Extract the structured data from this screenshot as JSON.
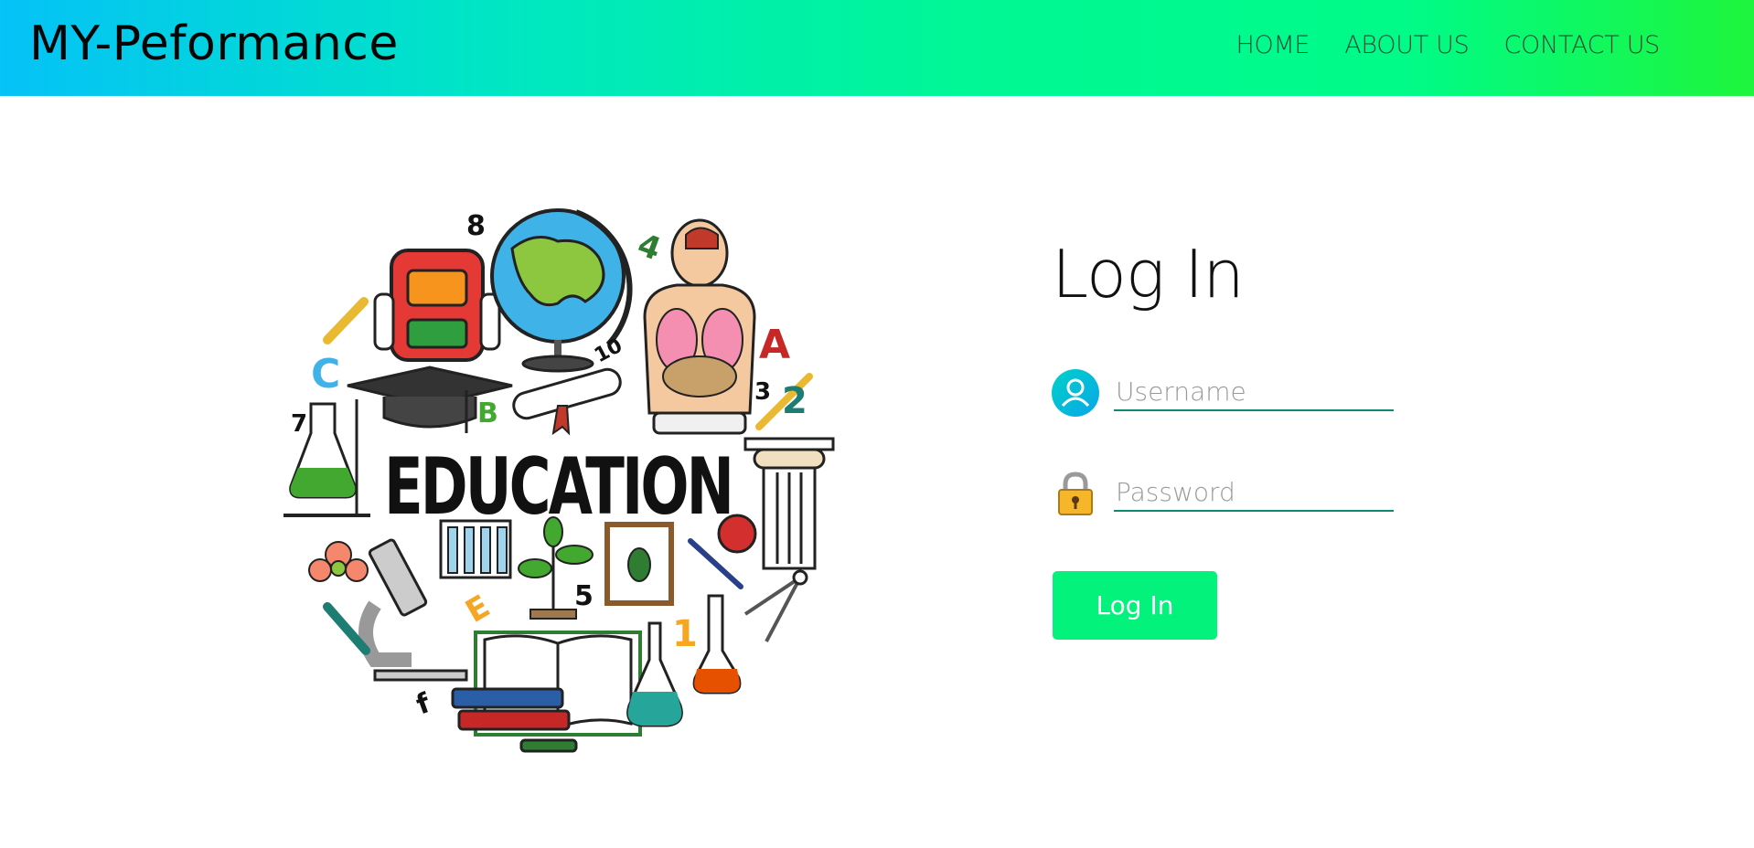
{
  "header": {
    "brand": "MY-Peformance",
    "nav": [
      "HOME",
      "ABOUT US",
      "CONTACT US"
    ]
  },
  "illustration": {
    "title": "EDUCATION",
    "numbers": [
      "8",
      "10",
      "3",
      "7",
      "5",
      "1"
    ],
    "letters": [
      "A",
      "B",
      "C",
      "E",
      "2",
      "4",
      "f"
    ]
  },
  "login": {
    "title": "Log In",
    "username_placeholder": "Username",
    "password_placeholder": "Password",
    "button_label": "Log In"
  },
  "colors": {
    "gradient_start": "#05c2f7",
    "gradient_end": "#1ef53c",
    "button": "#02f27c",
    "field_underline": "#0f8a72"
  }
}
